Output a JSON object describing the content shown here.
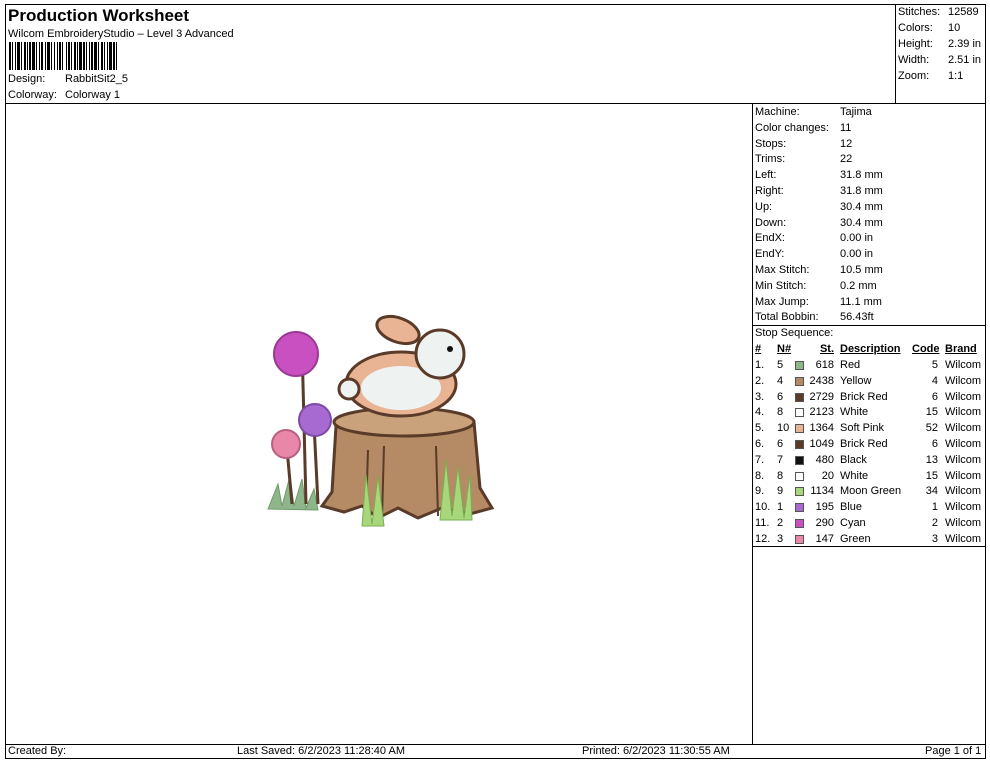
{
  "header": {
    "title": "Production Worksheet",
    "software": "Wilcom EmbroideryStudio – Level 3 Advanced",
    "design_label": "Design:",
    "design_value": "RabbitSit2_5",
    "colorway_label": "Colorway:",
    "colorway_value": "Colorway 1"
  },
  "summary": [
    {
      "label": "Stitches:",
      "value": "12589"
    },
    {
      "label": "Colors:",
      "value": "10"
    },
    {
      "label": "Height:",
      "value": "2.39 in"
    },
    {
      "label": "Width:",
      "value": "2.51 in"
    },
    {
      "label": "Zoom:",
      "value": "1:1"
    }
  ],
  "machine_info": [
    {
      "label": "Machine:",
      "value": "Tajima"
    },
    {
      "label": "Color changes:",
      "value": "11"
    },
    {
      "label": "Stops:",
      "value": "12"
    },
    {
      "label": "Trims:",
      "value": "22"
    },
    {
      "label": "Left:",
      "value": "31.8 mm"
    },
    {
      "label": "Right:",
      "value": "31.8 mm"
    },
    {
      "label": "Up:",
      "value": "30.4 mm"
    },
    {
      "label": "Down:",
      "value": "30.4 mm"
    },
    {
      "label": "EndX:",
      "value": "0.00 in"
    },
    {
      "label": "EndY:",
      "value": "0.00 in"
    },
    {
      "label": "Max Stitch:",
      "value": "10.5 mm"
    },
    {
      "label": "Min Stitch:",
      "value": "0.2 mm"
    },
    {
      "label": "Max Jump:",
      "value": "11.1 mm"
    },
    {
      "label": "Total Bobbin:",
      "value": "56.43ft"
    }
  ],
  "stop_sequence": {
    "title": "Stop Sequence:",
    "headers": {
      "idx": "#",
      "needle": "N#",
      "st": "St.",
      "description": "Description",
      "code": "Code",
      "brand": "Brand"
    },
    "rows": [
      {
        "idx": "1.",
        "needle": "5",
        "st": "618",
        "description": "Red",
        "code": "5",
        "brand": "Wilcom",
        "color": "#8fb58a"
      },
      {
        "idx": "2.",
        "needle": "4",
        "st": "2438",
        "description": "Yellow",
        "code": "4",
        "brand": "Wilcom",
        "color": "#b48b64"
      },
      {
        "idx": "3.",
        "needle": "6",
        "st": "2729",
        "description": "Brick Red",
        "code": "6",
        "brand": "Wilcom",
        "color": "#5a3a28"
      },
      {
        "idx": "4.",
        "needle": "8",
        "st": "2123",
        "description": "White",
        "code": "15",
        "brand": "Wilcom",
        "color": "#ffffff"
      },
      {
        "idx": "5.",
        "needle": "10",
        "st": "1364",
        "description": "Soft Pink",
        "code": "52",
        "brand": "Wilcom",
        "color": "#e8b494"
      },
      {
        "idx": "6.",
        "needle": "6",
        "st": "1049",
        "description": "Brick Red",
        "code": "6",
        "brand": "Wilcom",
        "color": "#5a3a28"
      },
      {
        "idx": "7.",
        "needle": "7",
        "st": "480",
        "description": "Black",
        "code": "13",
        "brand": "Wilcom",
        "color": "#111111"
      },
      {
        "idx": "8.",
        "needle": "8",
        "st": "20",
        "description": "White",
        "code": "15",
        "brand": "Wilcom",
        "color": "#ffffff"
      },
      {
        "idx": "9.",
        "needle": "9",
        "st": "1134",
        "description": "Moon Green",
        "code": "34",
        "brand": "Wilcom",
        "color": "#a8d67a"
      },
      {
        "idx": "10.",
        "needle": "1",
        "st": "195",
        "description": "Blue",
        "code": "1",
        "brand": "Wilcom",
        "color": "#a66ad0"
      },
      {
        "idx": "11.",
        "needle": "2",
        "st": "290",
        "description": "Cyan",
        "code": "2",
        "brand": "Wilcom",
        "color": "#c950c0"
      },
      {
        "idx": "12.",
        "needle": "3",
        "st": "147",
        "description": "Green",
        "code": "3",
        "brand": "Wilcom",
        "color": "#e887a8"
      }
    ]
  },
  "footer": {
    "created_by": "Created By:",
    "last_saved": "Last Saved: 6/2/2023 11:28:40 AM",
    "printed": "Printed: 6/2/2023 11:30:55 AM",
    "page": "Page 1 of 1"
  }
}
